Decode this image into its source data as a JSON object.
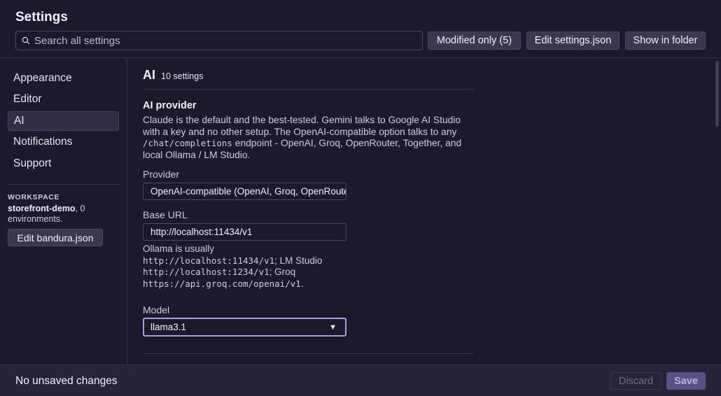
{
  "header": {
    "title": "Settings",
    "search_placeholder": "Search all settings",
    "buttons": {
      "modified": "Modified only (5)",
      "edit_json": "Edit settings.json",
      "show_folder": "Show in folder"
    }
  },
  "sidebar": {
    "items": [
      {
        "label": "Appearance"
      },
      {
        "label": "Editor"
      },
      {
        "label": "AI",
        "active": true
      },
      {
        "label": "Notifications"
      },
      {
        "label": "Support"
      }
    ],
    "workspace": {
      "heading": "WORKSPACE",
      "name": "storefront-demo",
      "rest": ", 0 environments.",
      "button": "Edit bandura.json"
    }
  },
  "main": {
    "section_title": "AI",
    "section_count": "10 settings",
    "setting": {
      "title": "AI provider",
      "desc_1": "Claude is the default and the best-tested. Gemini talks to Google AI Studio with a key and no other setup. The OpenAI-compatible option talks to any ",
      "desc_code": "/chat/completions",
      "desc_2": " endpoint - OpenAI, Groq, OpenRouter, Together, and local Ollama / LM Studio."
    },
    "provider": {
      "label": "Provider",
      "value": "OpenAI-compatible (OpenAI, Groq, OpenRouter, Together, Ollama)"
    },
    "base_url": {
      "label": "Base URL",
      "value": "http://localhost:11434/v1"
    },
    "help": {
      "t1": "Ollama is usually",
      "c1": "http://localhost:11434/v1",
      "t2": "; LM Studio",
      "c2": "http://localhost:1234/v1",
      "t3": "; Groq",
      "c3": "https://api.groq.com/openai/v1",
      "t4": "."
    },
    "model": {
      "label": "Model",
      "value": "llama3.1"
    }
  },
  "footer": {
    "status": "No unsaved changes",
    "discard": "Discard",
    "save": "Save"
  },
  "colors": {
    "background": "#1c1a2a",
    "accent": "#a99de0",
    "save_button": "#5a4f87"
  }
}
